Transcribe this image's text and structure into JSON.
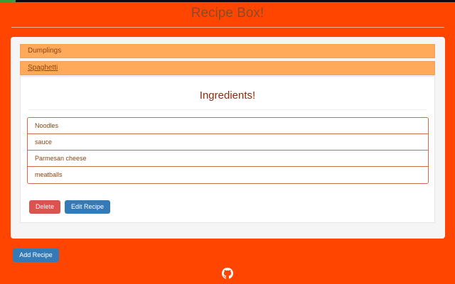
{
  "app": {
    "title": "Recipe Box!"
  },
  "recipes": [
    {
      "name": "Dumplings"
    },
    {
      "name": "Spaghetti"
    }
  ],
  "expanded_recipe": {
    "heading": "Ingredients!",
    "ingredients": [
      "Noodles",
      "sauce",
      "Parmesan cheese",
      "meatballs"
    ],
    "delete_label": "Delete",
    "edit_label": "Edit Recipe"
  },
  "footer": {
    "add_label": "Add Recipe",
    "github_icon": "github-icon"
  },
  "colors": {
    "background": "#ff4500",
    "header": "#ffa95b",
    "danger": "#d9534f",
    "primary": "#337ab7"
  }
}
